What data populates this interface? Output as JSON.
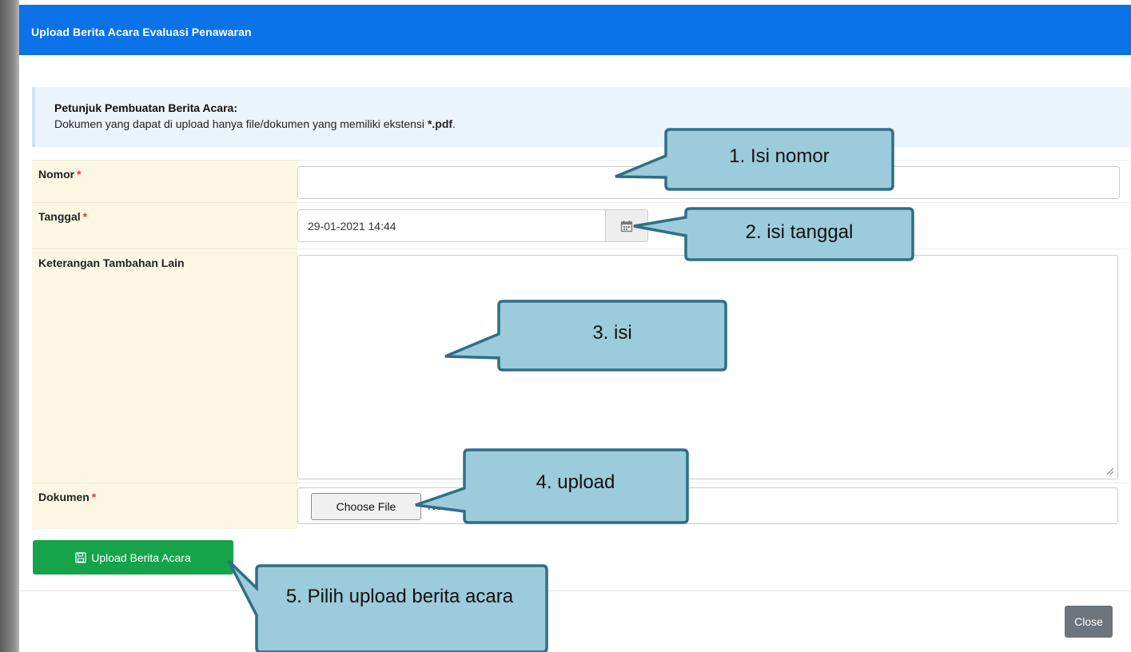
{
  "modal": {
    "title": "Upload Berita Acara Evaluasi Penawaran",
    "info_title": "Petunjuk Pembuatan Berita Acara:",
    "info_text_prefix": "Dokumen yang dapat di upload hanya file/dokumen yang memiliki ekstensi ",
    "info_text_ext": "*.pdf",
    "info_text_suffix": "."
  },
  "form": {
    "required_mark": "*",
    "nomor": {
      "label": "Nomor",
      "value": ""
    },
    "tanggal": {
      "label": "Tanggal",
      "value": "29-01-2021 14:44",
      "icon": "calendar-icon"
    },
    "keterangan": {
      "label": "Keterangan Tambahan Lain",
      "value": ""
    },
    "dokumen": {
      "label": "Dokumen",
      "button_label": "Choose File",
      "status_text": "No file chosen"
    }
  },
  "actions": {
    "upload_label": "Upload Berita Acara",
    "upload_icon": "save-icon",
    "close_label": "Close"
  },
  "callouts": [
    {
      "text": "1.  Isi nomor"
    },
    {
      "text": "2. isi tanggal"
    },
    {
      "text": "3. isi"
    },
    {
      "text": "4. upload"
    },
    {
      "text": "5. Pilih upload berita acara"
    }
  ],
  "colors": {
    "header_bg": "#0b72e8",
    "label_bg": "#fbf7e3",
    "info_bg": "#eaf4fb",
    "upload_button": "#16a34a",
    "close_button": "#6c757d",
    "callout_fill": "#9ccbdb",
    "callout_border": "#2f6f86",
    "required": "#e0393e"
  }
}
